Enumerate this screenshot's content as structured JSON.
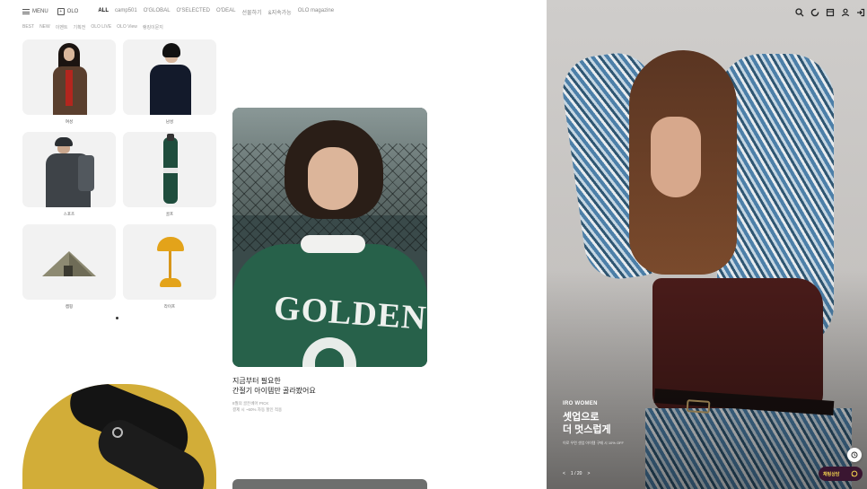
{
  "nav": {
    "menu_label": "MENU",
    "olo_label": "OLO",
    "olo_icon": "+",
    "categories": [
      "ALL",
      "camp501",
      "O'GLOBAL",
      "O'SELECTED",
      "O'DEAL",
      "선물하기",
      "&지속가능",
      "OLO magazine"
    ]
  },
  "subnav": {
    "items": [
      "BEST",
      "NEW",
      "이벤트",
      "기획전",
      "OLO LIVE",
      "OLO View",
      "랭킹이문지"
    ]
  },
  "category_grid": {
    "items": [
      {
        "label": "여성",
        "icon": "woman-fashion-icon"
      },
      {
        "label": "남성",
        "icon": "man-fashion-icon"
      },
      {
        "label": "스포츠",
        "icon": "sports-icon"
      },
      {
        "label": "골프",
        "icon": "golf-bag-icon"
      },
      {
        "label": "캠핑",
        "icon": "tent-icon"
      },
      {
        "label": "라이프",
        "icon": "lamp-icon"
      }
    ]
  },
  "feature": {
    "image_text": "GOLDEN",
    "title_line1": "지금부터 필요한",
    "title_line2": "간절기 아이템만 골라봤어요",
    "sub_line1": "8월의 골든베어 PICK",
    "sub_line2": "결제 시 ~60% 자동 할인 적용"
  },
  "hero": {
    "brand": "IRO WOMEN",
    "headline_line1": "셋업으로",
    "headline_line2": "더 멋스럽게",
    "description": "이로 우먼 셋업 아이템 구매 시 10% OFF",
    "pager_prev": "<",
    "pager_text": "1 / 20",
    "pager_next": ">"
  },
  "header_icons": [
    "search-icon",
    "loading-ring-icon",
    "bookmark-icon",
    "user-icon",
    "login-icon"
  ],
  "chat_button": {
    "label": "채팅상담",
    "icon": "chat-icon"
  },
  "colors": {
    "accent": "#3a1631",
    "chat_text": "#f2d24f",
    "feature_green": "#27614a"
  }
}
